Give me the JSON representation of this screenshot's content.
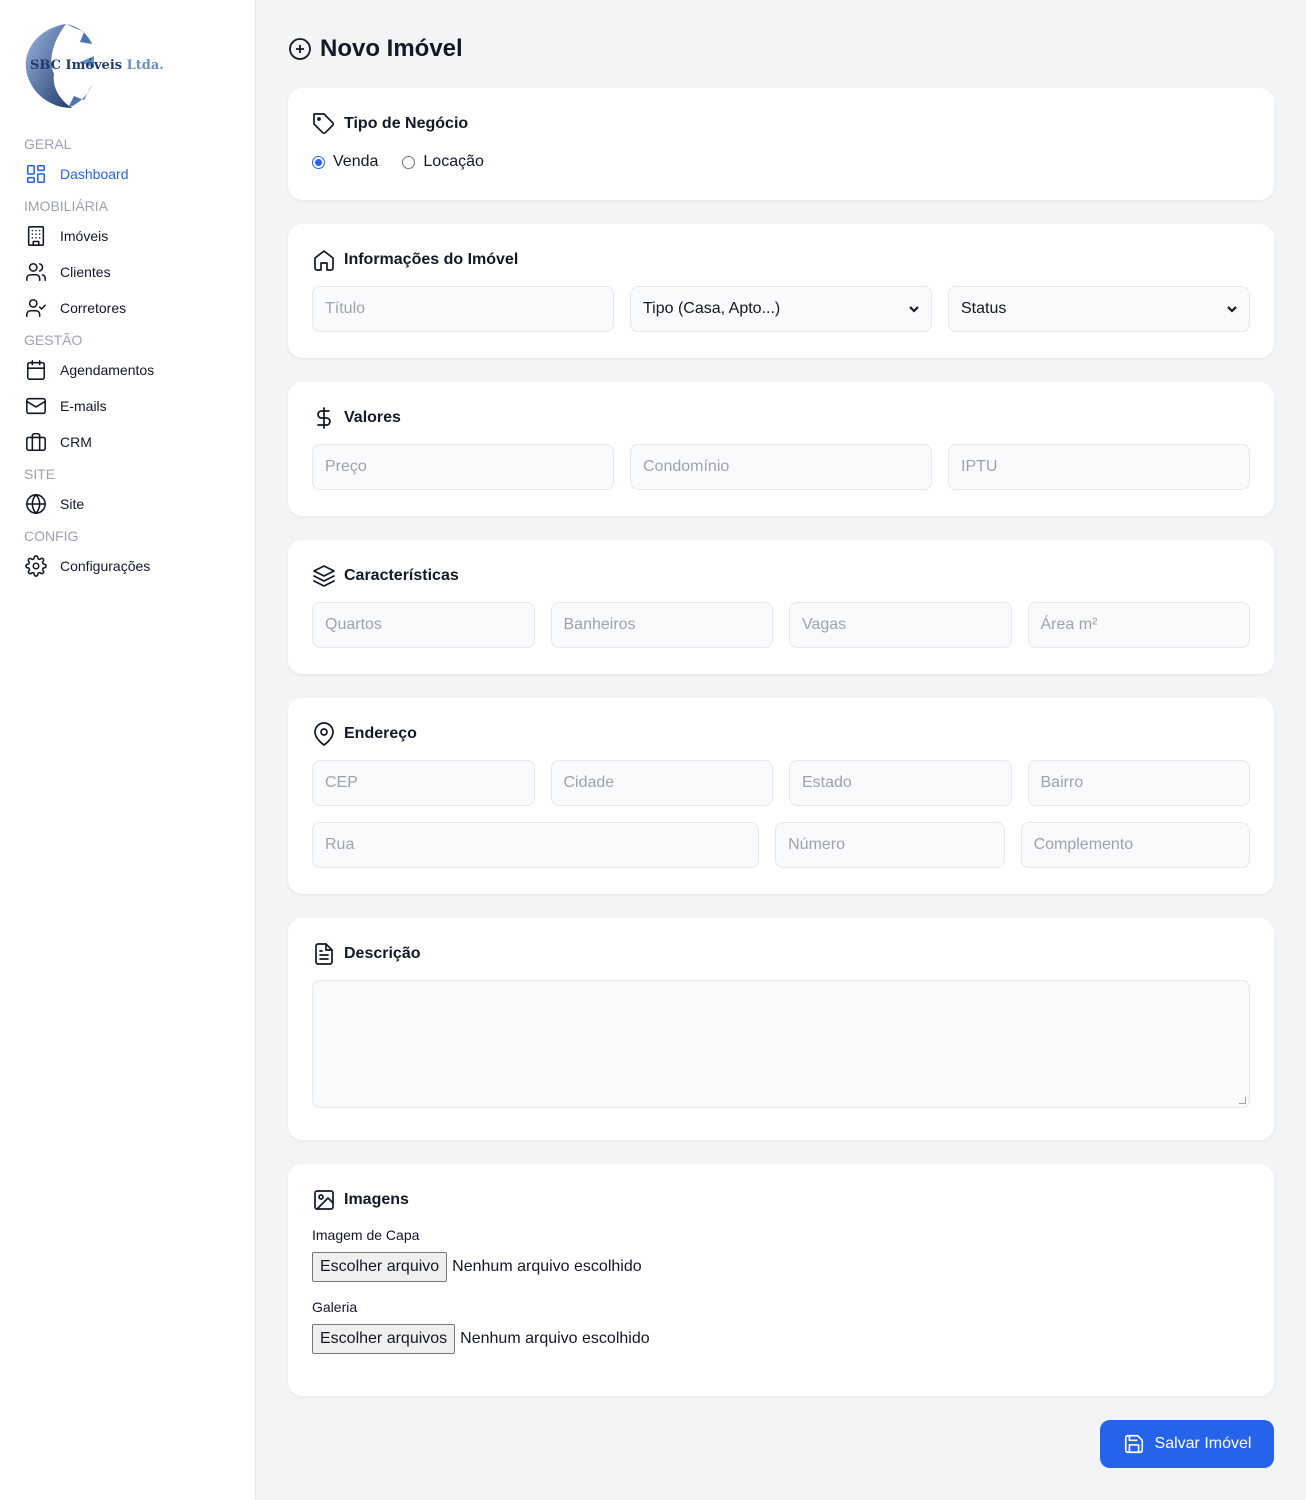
{
  "brand": {
    "name": "SBC Imóveis",
    "suffix": "Ltda."
  },
  "sidebar": {
    "sections": [
      {
        "title": "GERAL",
        "items": [
          {
            "label": "Dashboard",
            "icon": "dashboard-icon",
            "active": true
          }
        ]
      },
      {
        "title": "IMOBILIÁRIA",
        "items": [
          {
            "label": "Imóveis",
            "icon": "building-icon"
          },
          {
            "label": "Clientes",
            "icon": "users-icon"
          },
          {
            "label": "Corretores",
            "icon": "user-check-icon"
          }
        ]
      },
      {
        "title": "GESTÃO",
        "items": [
          {
            "label": "Agendamentos",
            "icon": "calendar-icon"
          },
          {
            "label": "E-mails",
            "icon": "mail-icon"
          },
          {
            "label": "CRM",
            "icon": "briefcase-icon"
          }
        ]
      },
      {
        "title": "SITE",
        "items": [
          {
            "label": "Site",
            "icon": "globe-icon"
          }
        ]
      },
      {
        "title": "CONFIG",
        "items": [
          {
            "label": "Configurações",
            "icon": "gear-icon"
          }
        ]
      }
    ]
  },
  "page": {
    "title": "Novo Imóvel"
  },
  "tipo_negocio": {
    "heading": "Tipo de Negócio",
    "options": [
      "Venda",
      "Locação"
    ],
    "selected": "Venda"
  },
  "informacoes": {
    "heading": "Informações do Imóvel",
    "titulo_placeholder": "Título",
    "tipo_select": "Tipo (Casa, Apto...)",
    "status_select": "Status"
  },
  "valores": {
    "heading": "Valores",
    "placeholders": [
      "Preço",
      "Condomínio",
      "IPTU"
    ]
  },
  "caracteristicas": {
    "heading": "Características",
    "placeholders": [
      "Quartos",
      "Banheiros",
      "Vagas",
      "Área m²"
    ]
  },
  "endereco": {
    "heading": "Endereço",
    "row1": [
      "CEP",
      "Cidade",
      "Estado",
      "Bairro"
    ],
    "rua": "Rua",
    "numero": "Número",
    "complemento": "Complemento"
  },
  "descricao": {
    "heading": "Descrição"
  },
  "imagens": {
    "heading": "Imagens",
    "capa_label": "Imagem de Capa",
    "capa_button": "Escolher arquivo",
    "capa_status": "Nenhum arquivo escolhido",
    "galeria_label": "Galeria",
    "galeria_button": "Escolher arquivos",
    "galeria_status": "Nenhum arquivo escolhido"
  },
  "actions": {
    "save_label": "Salvar Imóvel"
  },
  "colors": {
    "accent": "#2563eb",
    "background": "#f3f4f6",
    "card": "#ffffff"
  }
}
